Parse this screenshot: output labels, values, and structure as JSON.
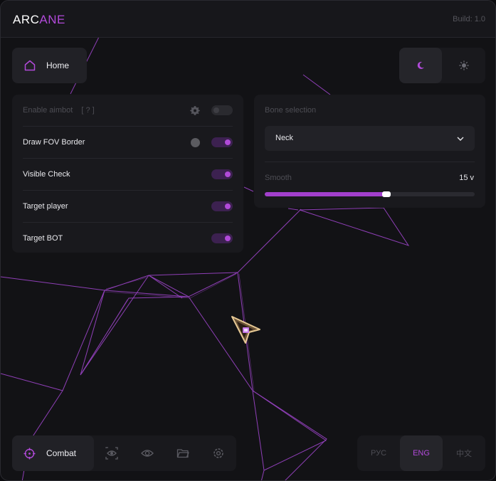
{
  "app": {
    "logo_a": "ARC",
    "logo_b": "ANE",
    "build": "Build: 1.0"
  },
  "home": {
    "label": "Home",
    "icon": "home-icon"
  },
  "theme": {
    "dark_icon": "moon-icon",
    "light_icon": "sun-icon",
    "active": "dark"
  },
  "aimbot": {
    "enable_label": "Enable aimbot",
    "enable_hint": "[ ? ]",
    "enable_on": false,
    "rows": [
      {
        "label": "Draw FOV Border",
        "on": true
      },
      {
        "label": "Visible Check",
        "on": true
      },
      {
        "label": "Target player",
        "on": true
      },
      {
        "label": "Target BOT",
        "on": true
      }
    ]
  },
  "bone": {
    "label": "Bone selection",
    "selected": "Neck",
    "smooth_label": "Smooth",
    "smooth_value": "15 v",
    "smooth_fraction": 0.58
  },
  "nav": {
    "active_label": "Combat",
    "icons": [
      "crosshair-icon",
      "eye-icon",
      "eye-icon",
      "folder-icon",
      "gear-icon"
    ]
  },
  "lang": {
    "options": [
      "РУС",
      "ENG",
      "中文"
    ],
    "active": "ENG"
  },
  "colors": {
    "accent": "#b14ad9",
    "background": "#121215",
    "panel": "#19191d"
  }
}
